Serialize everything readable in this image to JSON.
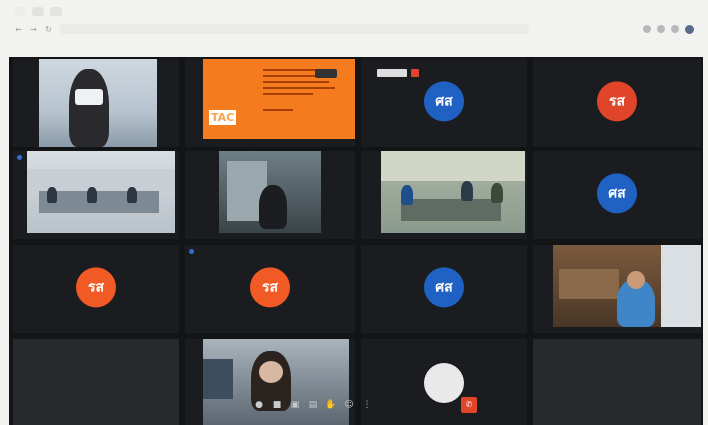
{
  "browser": {
    "tabs": [
      "",
      "",
      ""
    ],
    "address": "",
    "bookmarks": [
      "",
      "",
      "",
      "",
      ""
    ]
  },
  "meeting": {
    "tiles": [
      {
        "kind": "camera",
        "label": ""
      },
      {
        "kind": "presentation",
        "logo": "TAC",
        "label": ""
      },
      {
        "kind": "avatar",
        "initials": "ศส",
        "color": "#1f62c4",
        "label": ""
      },
      {
        "kind": "avatar",
        "initials": "รส",
        "color": "#e0452a",
        "label": ""
      },
      {
        "kind": "camera",
        "label": ""
      },
      {
        "kind": "camera",
        "label": ""
      },
      {
        "kind": "camera",
        "label": ""
      },
      {
        "kind": "avatar",
        "initials": "ศส",
        "color": "#1f62c4",
        "label": ""
      },
      {
        "kind": "avatar",
        "initials": "รส",
        "color": "#f15a24",
        "label": ""
      },
      {
        "kind": "avatar",
        "initials": "รส",
        "color": "#f15a24",
        "label": ""
      },
      {
        "kind": "avatar",
        "initials": "ศส",
        "color": "#1f62c4",
        "label": ""
      },
      {
        "kind": "camera",
        "label": ""
      },
      {
        "kind": "blank"
      },
      {
        "kind": "camera",
        "label": ""
      },
      {
        "kind": "camera",
        "label": ""
      },
      {
        "kind": "blank"
      }
    ],
    "controls": [
      "mic",
      "camera",
      "present",
      "captions",
      "raise-hand",
      "more"
    ],
    "end_call_icon": "end-call-icon"
  }
}
